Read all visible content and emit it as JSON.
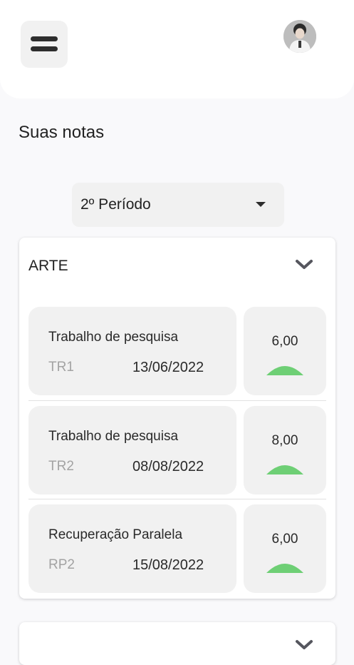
{
  "header": {
    "menu_icon": "hamburger-menu-icon",
    "avatar_icon": "user-avatar-icon"
  },
  "page": {
    "title": "Suas notas"
  },
  "period_select": {
    "selected": "2º Período",
    "icon": "dropdown-arrow-icon"
  },
  "subject": {
    "name": "ARTE",
    "toggle_icon": "chevron-down-icon",
    "grades": [
      {
        "description": "Trabalho de pesquisa",
        "code": "TR1",
        "date": "13/06/2022",
        "score": "6,00",
        "fraction": 0.6
      },
      {
        "description": "Trabalho de pesquisa",
        "code": "TR2",
        "date": "08/08/2022",
        "score": "8,00",
        "fraction": 0.8
      },
      {
        "description": "Recuperação Paralela",
        "code": "RP2",
        "date": "15/08/2022",
        "score": "6,00",
        "fraction": 0.6
      }
    ]
  },
  "colors": {
    "gauge_fill": "#6ecf75"
  }
}
